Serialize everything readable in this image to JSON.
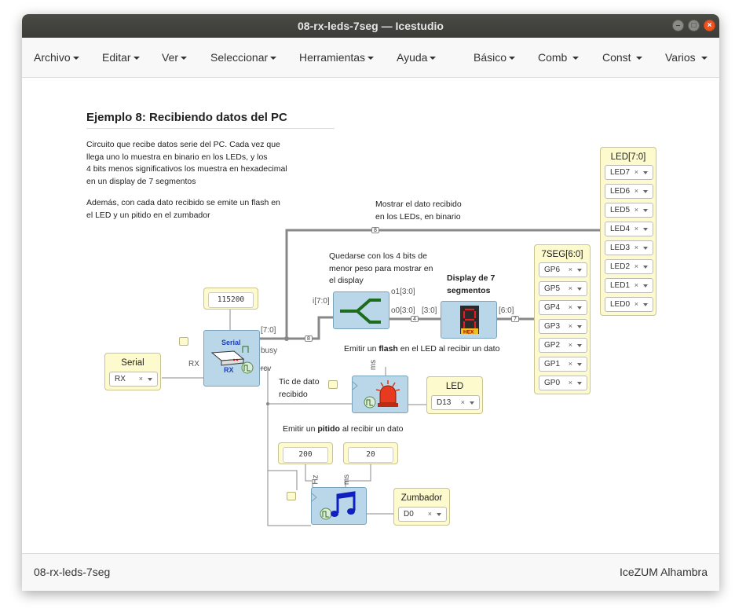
{
  "window": {
    "title": "08-rx-leds-7seg — Icestudio"
  },
  "menubar": {
    "left": [
      "Archivo",
      "Editar",
      "Ver",
      "Seleccionar",
      "Herramientas",
      "Ayuda"
    ],
    "right": [
      "Básico",
      "Comb ",
      "Const ",
      "Varios "
    ]
  },
  "canvas": {
    "heading": "Ejemplo 8: Recibiendo datos del PC",
    "intro_lines": [
      "Circuito que recibe datos serie del PC. Cada vez que",
      "llega uno lo muestra en binario en los LEDs, y los",
      "4 bits menos significativos los muestra en hexadecimal",
      "en un display de 7 segmentos"
    ],
    "intro2_lines": [
      "Además, con cada dato recibido se emite un flash en",
      "el LED y un pitido en el zumbador"
    ],
    "note_leds": [
      "Mostrar el dato recibido",
      "en los LEDs, en binario"
    ],
    "note_split": [
      "Quedarse con los 4 bits de",
      "menor peso para mostrar en",
      "el display"
    ],
    "note_display": [
      "Display de 7",
      "segmentos"
    ],
    "note_flash": {
      "pre": "Emitir un ",
      "bold": "flash",
      "post": " en el LED al recibir un dato"
    },
    "note_tic": [
      "Tic de dato",
      "recibido"
    ],
    "note_beep": {
      "pre": "Emitir un ",
      "bold": "pitido",
      "post": " al recibir un dato"
    },
    "serial_in": {
      "label": "Serial",
      "pin": "RX",
      "clear": "×"
    },
    "baud_const": "115200",
    "serial_block": {
      "title": "Serial",
      "sub": "RX",
      "out_data": "[7:0]",
      "out_busy": "busy",
      "out_rcv": "rcv",
      "in_rx": "RX"
    },
    "split_block": {
      "in": "i[7:0]",
      "out1": "o1[3:0]",
      "out0": "o0[3:0]"
    },
    "seg_block": {
      "in": "[3:0]",
      "out": "[6:0]",
      "hex": "HEX"
    },
    "bus_labels": {
      "b8a": "8",
      "b8b": "8",
      "b4": "4",
      "b7": "7"
    },
    "leds_out": {
      "label": "LED[7:0]",
      "pins": [
        "LED7",
        "LED6",
        "LED5",
        "LED4",
        "LED3",
        "LED2",
        "LED1",
        "LED0"
      ]
    },
    "seg_out": {
      "label": "7SEG[6:0]",
      "pins": [
        "GP6",
        "GP5",
        "GP4",
        "GP3",
        "GP2",
        "GP1",
        "GP0"
      ]
    },
    "led_out": {
      "label": "LED",
      "pin": "D13"
    },
    "flash_block": {
      "param": "ms"
    },
    "beep_consts": {
      "hz": "200",
      "ms": "20"
    },
    "beep_block": {
      "param_hz": "Hz",
      "param_ms": "ms"
    },
    "buzzer_out": {
      "label": "Zumbador",
      "pin": "D0"
    }
  },
  "footer": {
    "left": "08-rx-leds-7seg",
    "right": "IceZUM Alhambra"
  },
  "colors": {
    "block": "#b9d7e8",
    "io": "#fdfacd",
    "accent": "#e95420",
    "wire": "#777777"
  }
}
